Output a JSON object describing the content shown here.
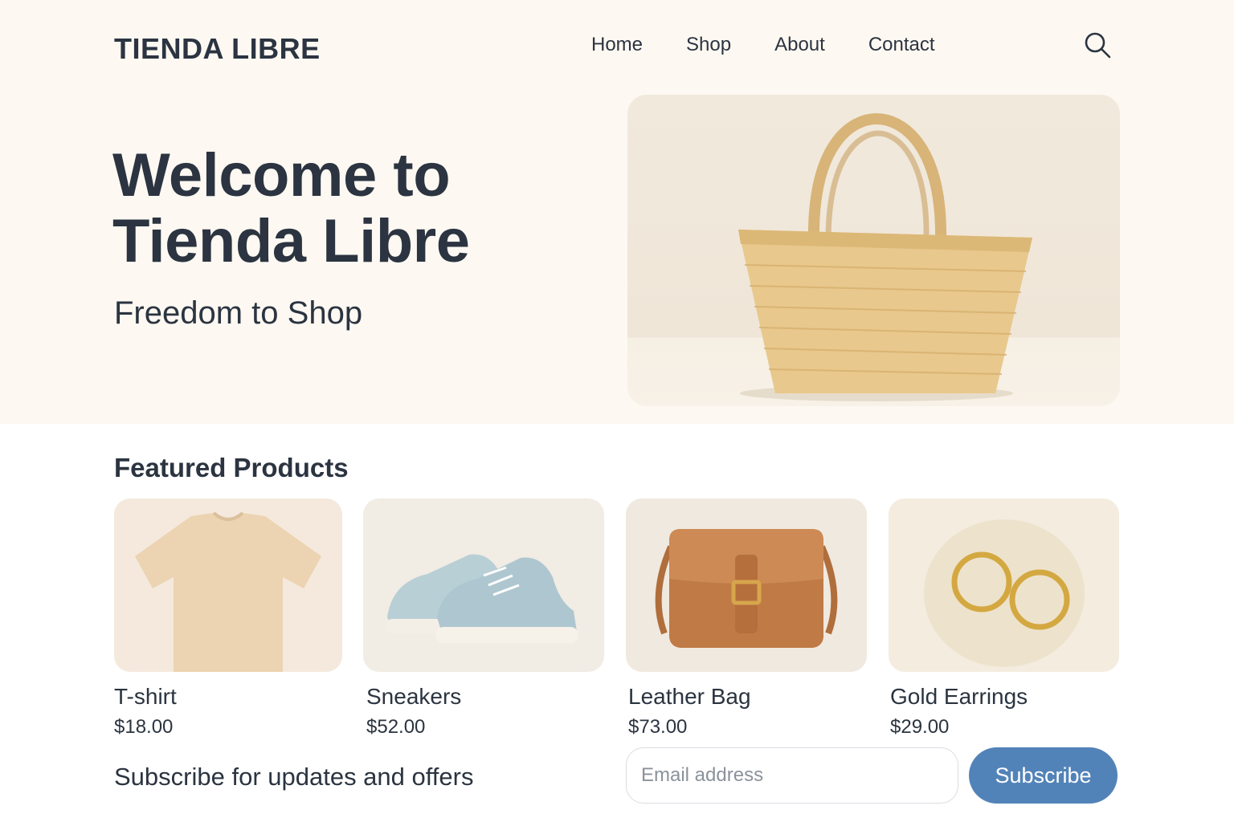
{
  "header": {
    "brand": "TIENDA LIBRE",
    "nav": [
      "Home",
      "Shop",
      "About",
      "Contact"
    ],
    "search_icon": "search-icon"
  },
  "hero": {
    "title_line1": "Welcome to",
    "title_line2": "Tienda Libre",
    "subtitle": "Freedom to Shop",
    "image": "straw-tote-bag"
  },
  "featured": {
    "title": "Featured Products",
    "products": [
      {
        "name": "T-shirt",
        "price": "$18.00",
        "image": "beige-tshirt"
      },
      {
        "name": "Sneakers",
        "price": "$52.00",
        "image": "light-blue-sneakers"
      },
      {
        "name": "Leather Bag",
        "price": "$73.00",
        "image": "brown-leather-crossbody-bag"
      },
      {
        "name": "Gold Earrings",
        "price": "$29.00",
        "image": "gold-hoop-earrings"
      }
    ]
  },
  "subscribe": {
    "text": "Subscribe for updates and offers",
    "email_placeholder": "Email address",
    "button_label": "Subscribe"
  },
  "colors": {
    "hero_background": "#fdf8f2",
    "text": "#2b3440",
    "subscribe_button": "#5283b8"
  }
}
